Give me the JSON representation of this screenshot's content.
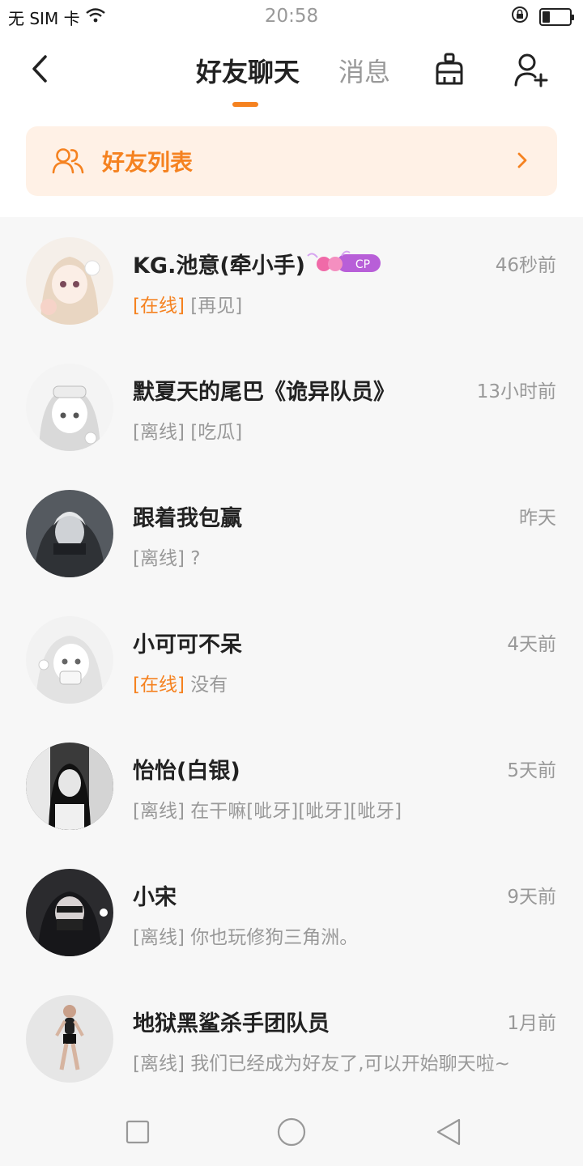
{
  "status_bar": {
    "carrier": "无 SIM 卡",
    "time": "20:58"
  },
  "header": {
    "tab_friends": "好友聊天",
    "tab_messages": "消息"
  },
  "friends_list_bar": {
    "label": "好友列表"
  },
  "colors": {
    "accent": "#f58220",
    "muted": "#999999",
    "background": "#f7f7f7"
  },
  "chats": [
    {
      "name": "KG.池意(牵小手)",
      "time": "46秒前",
      "status": "[在线]",
      "online": true,
      "message": "[再见]",
      "badge": "CP"
    },
    {
      "name": "默夏天的尾巴《诡异队员》",
      "time": "13小时前",
      "status": "[离线]",
      "online": false,
      "message": "[吃瓜]"
    },
    {
      "name": "跟着我包赢",
      "time": "昨天",
      "status": "[离线]",
      "online": false,
      "message": "?"
    },
    {
      "name": "小可可不呆",
      "time": "4天前",
      "status": "[在线]",
      "online": true,
      "message": "没有"
    },
    {
      "name": "怡怡(白银)",
      "time": "5天前",
      "status": "[离线]",
      "online": false,
      "message": "在干嘛[呲牙][呲牙][呲牙]"
    },
    {
      "name": "小宋",
      "time": "9天前",
      "status": "[离线]",
      "online": false,
      "message": "你也玩修狗三角洲。"
    },
    {
      "name": "地狱黑鲨杀手团队员",
      "time": "1月前",
      "status": "[离线]",
      "online": false,
      "message": "我们已经成为好友了,可以开始聊天啦~"
    }
  ]
}
